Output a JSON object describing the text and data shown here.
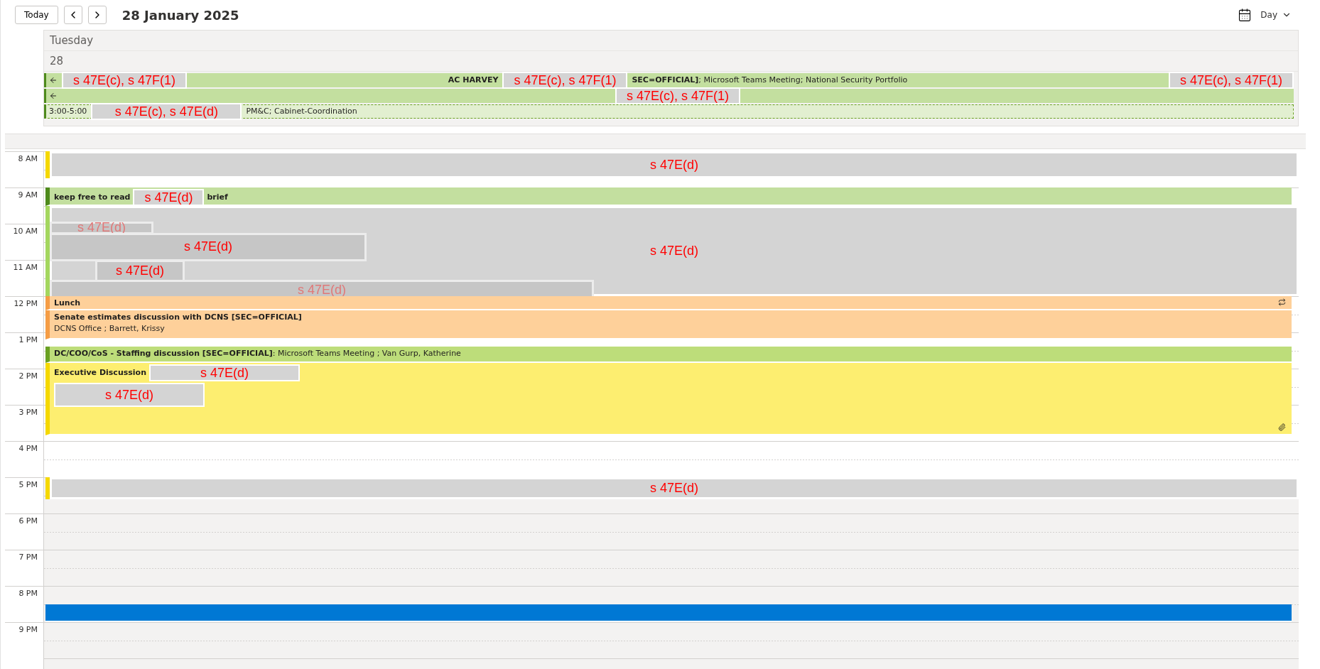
{
  "toolbar": {
    "today": "Today",
    "date": "28 January 2025",
    "view": "Day"
  },
  "day": {
    "weekday": "Tuesday",
    "date": "28"
  },
  "all_day": [
    {
      "kind": "solid",
      "color": "#c3df9f",
      "parts": [
        {
          "kind": "arrow"
        },
        {
          "kind": "redaction",
          "text": "s 47E(c), s 47F(1)"
        },
        {
          "kind": "gap"
        },
        {
          "kind": "bold",
          "text": "AC HARVEY"
        },
        {
          "kind": "redaction",
          "text": "s 47E(c), s 47F(1)"
        },
        {
          "kind": "text",
          "text": "**SEC=OFFICIAL]**; Microsoft Teams Meeting; National Security Portfolio"
        },
        {
          "kind": "gap"
        },
        {
          "kind": "redaction",
          "text": "s 47E(c), s 47F(1)"
        }
      ]
    },
    {
      "kind": "solid",
      "color": "#c3df9f",
      "parts": [
        {
          "kind": "arrow"
        },
        {
          "kind": "gap"
        },
        {
          "kind": "redaction",
          "text": "s 47E(c), s 47F(1)"
        },
        {
          "kind": "gap"
        }
      ]
    },
    {
      "kind": "tentative",
      "color": "#e2efd0",
      "parts": [
        {
          "kind": "text",
          "text": "3:00-5:00"
        },
        {
          "kind": "redaction-wide",
          "text": "s 47E(c), s 47E(d)"
        },
        {
          "kind": "text",
          "text": "PM&C; Cabinet-Coordination"
        }
      ]
    }
  ],
  "hours": [
    "8 AM",
    "9 AM",
    "10 AM",
    "11 AM",
    "12 PM",
    "1 PM",
    "2 PM",
    "3 PM",
    "4 PM",
    "5 PM",
    "6 PM",
    "7 PM",
    "8 PM",
    "9 PM"
  ],
  "events": [
    {
      "kind": "redacted",
      "color": "#f5d800",
      "label": "s 47E(d)"
    },
    {
      "kind": "event",
      "color": "#c3df9f",
      "parts": [
        {
          "kind": "bold",
          "text": "keep free to read"
        },
        {
          "kind": "redaction",
          "text": "s 47E(d)"
        },
        {
          "kind": "bold",
          "text": "brief"
        }
      ]
    },
    {
      "kind": "redacted",
      "color": "#a4d65e",
      "label": "s 47E(d)",
      "blocks": [
        {
          "label": "s 47E(d)",
          "faded": true
        },
        {
          "label": "s 47E(d)",
          "faded": false
        },
        {
          "label": "s 47E(d)",
          "faded": false
        },
        {
          "label": "s 47E(d)",
          "faded": true
        }
      ]
    },
    {
      "kind": "event-exception",
      "color": "#fed09a",
      "parts": [
        {
          "kind": "bold",
          "text": "Lunch"
        }
      ]
    },
    {
      "kind": "event",
      "color": "#fed09a",
      "parts": [
        {
          "kind": "bold",
          "text": "Senate estimates discussion with DCNS [SEC=OFFICIAL]"
        },
        {
          "kind": "break"
        },
        {
          "kind": "text",
          "text": "DCNS Office ; Barrett, Krissy"
        }
      ]
    },
    {
      "kind": "event",
      "color": "#bddd7a",
      "parts": [
        {
          "kind": "text",
          "text": "**DC/COO/CoS - Staffing discussion [SEC=OFFICIAL]**: Microsoft Teams Meeting ; Van Gurp, Katherine"
        }
      ]
    },
    {
      "kind": "event-attachment",
      "color": "#fdee70",
      "parts": [
        {
          "kind": "bold",
          "text": "Executive Discussion"
        },
        {
          "kind": "redaction-wide",
          "text": "s 47E(d)"
        },
        {
          "kind": "break"
        },
        {
          "kind": "redaction-block",
          "text": "s 47E(d)"
        }
      ]
    },
    {
      "kind": "redacted",
      "color": "#f5d800",
      "label": "s 47E(d)"
    },
    {
      "kind": "event",
      "color": "#0078d4"
    }
  ]
}
